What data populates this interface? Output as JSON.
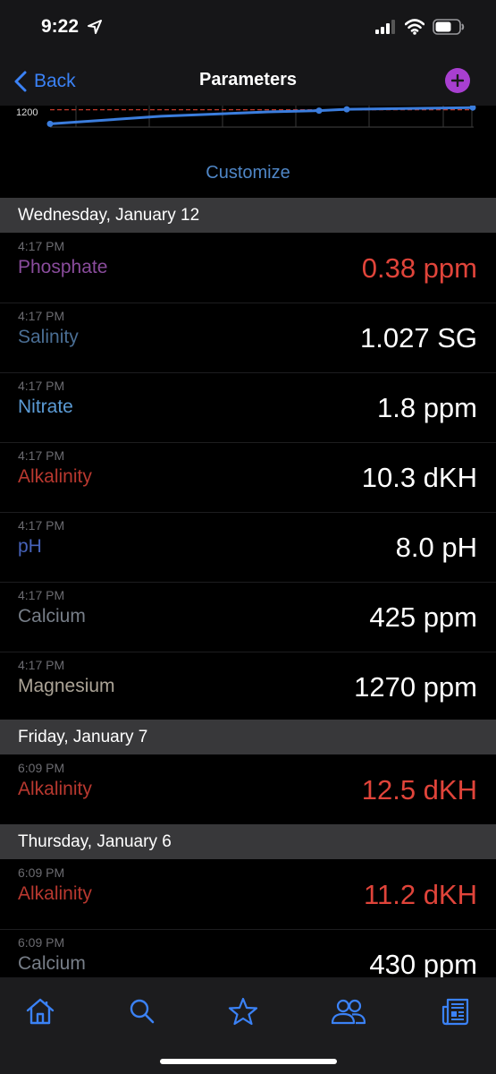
{
  "status": {
    "time": "9:22"
  },
  "nav": {
    "back_label": "Back",
    "title": "Parameters"
  },
  "chart_data": {
    "type": "line",
    "y_tick": "1200",
    "series": [
      {
        "values": [
          1195,
          1230,
          1250,
          1256,
          1262,
          1270
        ]
      }
    ],
    "threshold": 1260,
    "colors": {
      "line": "#3b7ddd",
      "threshold": "#c0392b"
    }
  },
  "customize_label": "Customize",
  "sections": [
    {
      "date": "Wednesday, January 12",
      "entries": [
        {
          "time": "4:17 PM",
          "name": "Phosphate",
          "value": "0.38 ppm",
          "name_color": "#8a4c9c",
          "alert": true
        },
        {
          "time": "4:17 PM",
          "name": "Salinity",
          "value": "1.027 SG",
          "name_color": "#4a6e94",
          "alert": false
        },
        {
          "time": "4:17 PM",
          "name": "Nitrate",
          "value": "1.8 ppm",
          "name_color": "#5b9bd5",
          "alert": false
        },
        {
          "time": "4:17 PM",
          "name": "Alkalinity",
          "value": "10.3 dKH",
          "name_color": "#b8382f",
          "alert": false
        },
        {
          "time": "4:17 PM",
          "name": "pH",
          "value": "8.0 pH",
          "name_color": "#4763bb",
          "alert": false
        },
        {
          "time": "4:17 PM",
          "name": "Calcium",
          "value": "425 ppm",
          "name_color": "#777e88",
          "alert": false
        },
        {
          "time": "4:17 PM",
          "name": "Magnesium",
          "value": "1270 ppm",
          "name_color": "#aba396",
          "alert": false
        }
      ]
    },
    {
      "date": "Friday, January 7",
      "entries": [
        {
          "time": "6:09 PM",
          "name": "Alkalinity",
          "value": "12.5 dKH",
          "name_color": "#b8382f",
          "alert": true
        }
      ]
    },
    {
      "date": "Thursday, January 6",
      "entries": [
        {
          "time": "6:09 PM",
          "name": "Alkalinity",
          "value": "11.2 dKH",
          "name_color": "#b8382f",
          "alert": true
        },
        {
          "time": "6:09 PM",
          "name": "Calcium",
          "value": "430 ppm",
          "name_color": "#777e88",
          "alert": false
        }
      ]
    }
  ],
  "tabs": [
    {
      "name": "tab-home",
      "icon": "home-icon"
    },
    {
      "name": "tab-search",
      "icon": "search-icon"
    },
    {
      "name": "tab-favorites",
      "icon": "star-icon"
    },
    {
      "name": "tab-community",
      "icon": "people-icon"
    },
    {
      "name": "tab-news",
      "icon": "newspaper-icon"
    }
  ],
  "colors": {
    "accent": "#3b82f6",
    "add_button": "#a83fd0",
    "alert": "#e0443a"
  }
}
